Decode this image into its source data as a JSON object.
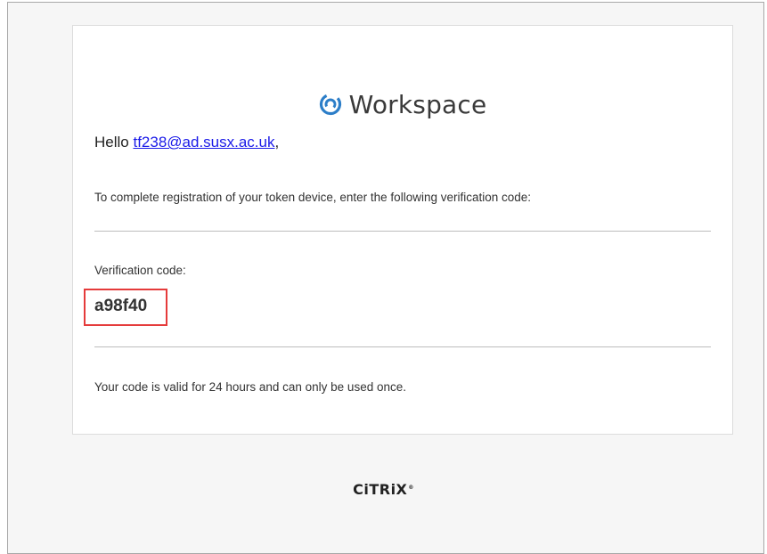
{
  "brand": {
    "name": "Workspace",
    "accent_color": "#2c7ec8",
    "icon": "citrix-workspace-swirl-icon"
  },
  "greeting": {
    "prefix": "Hello ",
    "email": "tf238@ad.susx.ac.uk",
    "suffix": ","
  },
  "instructions": "To complete registration of your token device, enter the following verification code:",
  "verification": {
    "label": "Verification code:",
    "code": "a98f40",
    "highlight_color": "#e53b3b"
  },
  "validity": "Your code is valid for 24 hours and can only be used once.",
  "footer": {
    "logo": "CiTRiX",
    "trademark": "®"
  }
}
